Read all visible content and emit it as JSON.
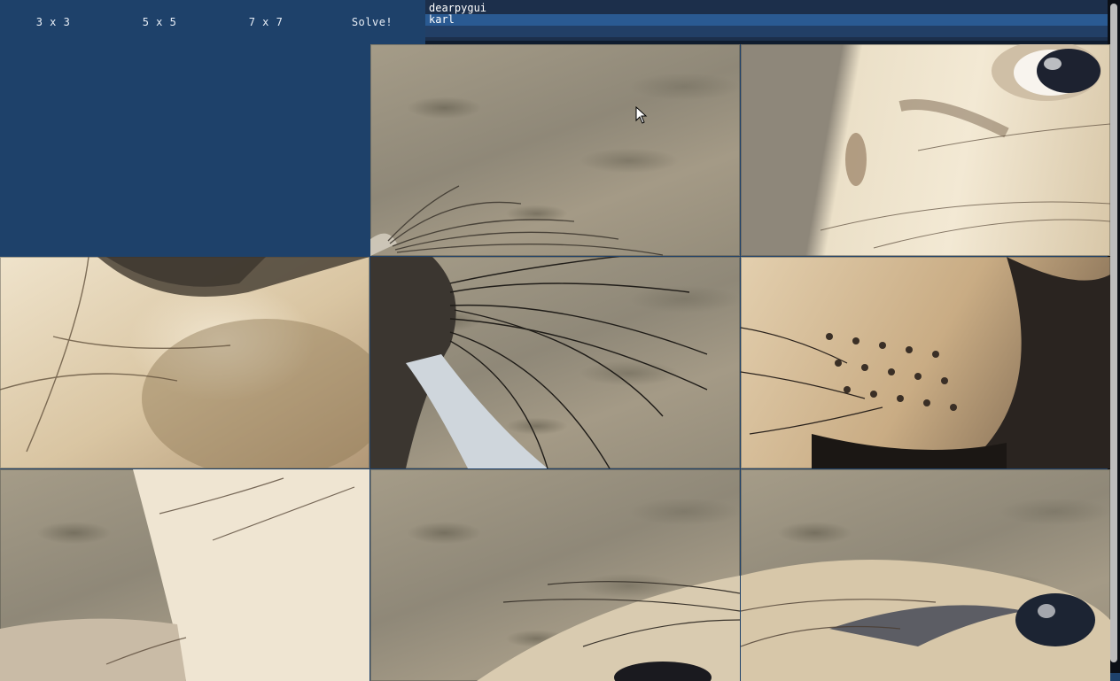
{
  "toolbar": {
    "buttons": [
      {
        "label": "3 x 3"
      },
      {
        "label": "5 x 5"
      },
      {
        "label": "7 x 7"
      },
      {
        "label": "Solve!"
      }
    ]
  },
  "listbox": {
    "items": [
      "dearpygui",
      "karl"
    ],
    "selected": "karl"
  },
  "puzzle": {
    "grid_size": "3 x 3",
    "image_subject": "seal",
    "tiles": [
      {
        "row": 0,
        "col": 0,
        "empty": true
      },
      {
        "row": 0,
        "col": 1,
        "content": "rocky-ground"
      },
      {
        "row": 0,
        "col": 2,
        "content": "seal-eye"
      },
      {
        "row": 1,
        "col": 0,
        "content": "seal-chin-fur"
      },
      {
        "row": 1,
        "col": 1,
        "content": "seal-whiskers"
      },
      {
        "row": 1,
        "col": 2,
        "content": "seal-muzzle"
      },
      {
        "row": 2,
        "col": 0,
        "content": "seal-neck"
      },
      {
        "row": 2,
        "col": 1,
        "content": "rocky-ground-whiskers"
      },
      {
        "row": 2,
        "col": 2,
        "content": "seal-head-eye"
      }
    ]
  },
  "colors": {
    "panel": "#1e416a",
    "listbox_bg": "#1c2f4b",
    "selected_row": "#2a5a92"
  }
}
